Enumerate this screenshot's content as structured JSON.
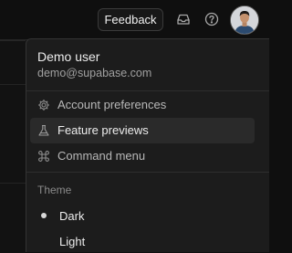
{
  "header": {
    "feedback_label": "Feedback",
    "icons": [
      "inbox-icon",
      "help-icon",
      "avatar"
    ]
  },
  "user_menu": {
    "name": "Demo user",
    "email": "demo@supabase.com",
    "items": [
      {
        "label": "Account preferences",
        "icon": "gear-icon"
      },
      {
        "label": "Feature previews",
        "icon": "flask-icon",
        "highlighted": true
      },
      {
        "label": "Command menu",
        "icon": "command-icon"
      }
    ],
    "theme": {
      "section_label": "Theme",
      "options": [
        {
          "label": "Dark",
          "selected": true
        },
        {
          "label": "Light",
          "selected": false
        }
      ]
    }
  },
  "colors": {
    "background": "#0f0f0f",
    "menu_background": "#1c1c1c",
    "highlight": "#2a2a2a",
    "text_primary": "#ededed",
    "text_secondary": "#a0a0a0"
  }
}
